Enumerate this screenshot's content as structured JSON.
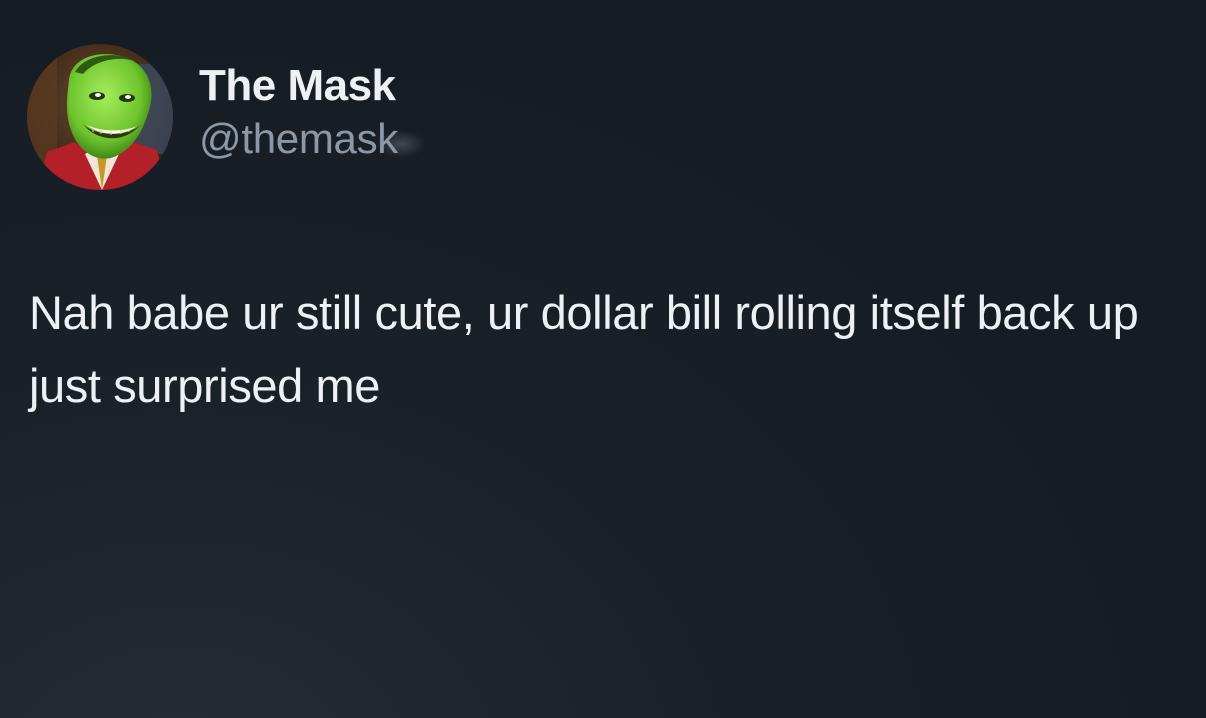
{
  "tweet": {
    "display_name": "The Mask",
    "handle": "@themask",
    "text": "Nah babe ur still cute, ur dollar bill rolling itself back up just surprised me"
  },
  "avatar": {
    "icon": "green-mask-face-avatar-icon",
    "face_color": "#7fd13b",
    "background_color": "#4a2a18"
  },
  "colors": {
    "background": "#171d24",
    "primary_text": "#eef1f3",
    "secondary_text": "#8b98a5"
  }
}
